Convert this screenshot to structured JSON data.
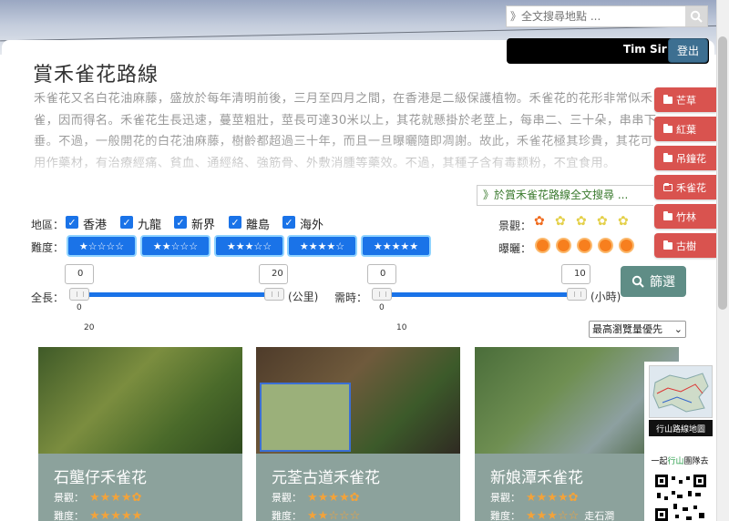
{
  "header": {
    "search_placeholder": "》全文搜尋地點 ...",
    "username": "Tim Sir",
    "logout_label": "登出"
  },
  "page": {
    "title": "賞禾雀花路線",
    "description": "禾雀花又名白花油麻藤，盛放於每年清明前後，三月至四月之間，在香港是二級保護植物。禾雀花的花形非常似禾雀，因而得名。禾雀花生長迅速，蔓莖粗壯，莖長可達30米以上，其花就懸掛於老莖上，每串二、三十朵，串串下垂。不過，一般開花的白花油麻藤，樹齡都超過三十年，而且一旦曝曬隨即凋謝。故此，禾雀花極其珍貴，其花可用作藥材，有治療經痛、貧血、通經絡、強筋骨、外敷消腫等藥效。不過，其種子含有毒颣粉，不宜食用。",
    "fulltext_search_label": "》於賞禾雀花路線全文搜尋 ..."
  },
  "side_tabs": [
    {
      "label": "芒草",
      "icon": "folder-icon"
    },
    {
      "label": "紅葉",
      "icon": "folder-icon"
    },
    {
      "label": "吊鐘花",
      "icon": "folder-icon"
    },
    {
      "label": "禾雀花",
      "icon": "folder-open-icon"
    },
    {
      "label": "竹林",
      "icon": "folder-icon"
    },
    {
      "label": "古樹",
      "icon": "folder-icon"
    }
  ],
  "filters": {
    "region_label": "地區：",
    "regions": [
      "香港",
      "九龍",
      "新界",
      "離島",
      "海外"
    ],
    "difficulty_label": "難度：",
    "difficulty_buttons": [
      "★☆☆☆☆",
      "★★☆☆☆",
      "★★★☆☆",
      "★★★★☆",
      "★★★★★"
    ],
    "scenery_label": "景觀：",
    "sun_label": "曝曬：",
    "length_label": "全長：",
    "length_unit": "(公里)",
    "length_min": "0",
    "length_max": "20",
    "length_tick_low": "0",
    "length_tick_high": "20",
    "time_label": "需時：",
    "time_unit": "(小時)",
    "time_min": "0",
    "time_max": "10",
    "time_tick_low": "0",
    "time_tick_high": "10",
    "filter_button": "篩選",
    "sort_selected": "最高瀏覽量優先"
  },
  "cards": [
    {
      "title": "石壟仔禾雀花",
      "scenery_label": "景觀：",
      "difficulty_label": "難度：",
      "scenery": "★★★★✿",
      "difficulty": "★★★★★",
      "extra": ""
    },
    {
      "title": "元荃古道禾雀花",
      "scenery_label": "景觀：",
      "difficulty_label": "難度：",
      "scenery": "★★★★✿",
      "difficulty": "★★☆☆☆",
      "extra": ""
    },
    {
      "title": "新娘潭禾雀花",
      "scenery_label": "景觀：",
      "difficulty_label": "難度：",
      "scenery": "★★★★✿",
      "difficulty": "★★★☆☆",
      "extra": "走石澗"
    }
  ],
  "widgets": {
    "map_label": "行山路線地圖",
    "join_prefix": "一起",
    "join_highlight": "行山",
    "join_suffix": "團隊去"
  }
}
